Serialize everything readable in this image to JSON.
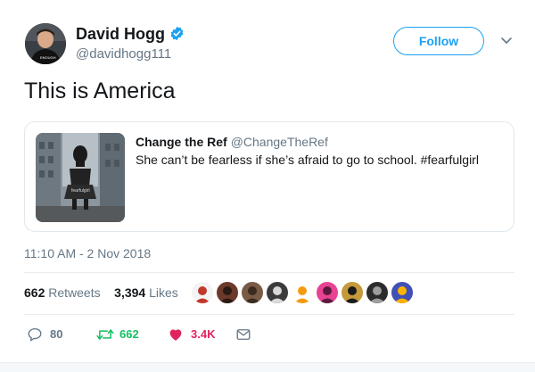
{
  "author": {
    "name": "David Hogg",
    "handle": "@davidhogg111",
    "verified": true,
    "avatar_shirt_text": "ENOUGH"
  },
  "follow_button": {
    "label": "Follow"
  },
  "tweet": {
    "text": "This is America"
  },
  "quoted_tweet": {
    "name": "Change the Ref",
    "handle": "@ChangeTheRef",
    "text": "She can’t be fearless if she’s afraid to go to school.  #fearfulgirl",
    "image_label": "fearfulgirl"
  },
  "timestamp": "11:10 AM - 2 Nov 2018",
  "stats": {
    "retweets_count": "662",
    "retweets_label": "Retweets",
    "likes_count": "3,394",
    "likes_label": "Likes"
  },
  "liker_avatars": [
    {
      "name": "liker-avatar-1",
      "bg": "#f4f4f4",
      "fg": "#c0392b"
    },
    {
      "name": "liker-avatar-2",
      "bg": "#6b3a2a",
      "fg": "#2b1a12"
    },
    {
      "name": "liker-avatar-3",
      "bg": "#7a5b45",
      "fg": "#3a2a20"
    },
    {
      "name": "liker-avatar-4",
      "bg": "#3b3b3b",
      "fg": "#d9d9d9"
    },
    {
      "name": "liker-avatar-5",
      "bg": "#ffffff",
      "fg": "#f39c12"
    },
    {
      "name": "liker-avatar-6",
      "bg": "#e84393",
      "fg": "#5b1a3d"
    },
    {
      "name": "liker-avatar-7",
      "bg": "#c49a3a",
      "fg": "#1b1b1b"
    },
    {
      "name": "liker-avatar-8",
      "bg": "#2c2c2c",
      "fg": "#9e9e9e"
    },
    {
      "name": "liker-avatar-9",
      "bg": "#3f51b5",
      "fg": "#ffb300"
    }
  ],
  "actions": {
    "replies": "80",
    "retweets": "662",
    "likes": "3.4K"
  },
  "colors": {
    "accent": "#1da1f2",
    "retweet": "#17bf63",
    "like": "#e0245e",
    "secondary_text": "#657786"
  }
}
